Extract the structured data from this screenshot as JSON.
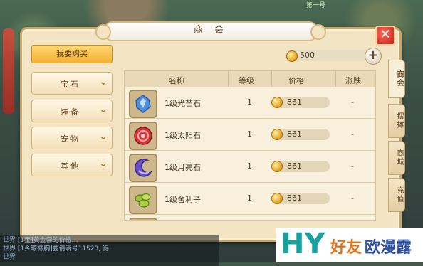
{
  "window": {
    "title": "商 会"
  },
  "background": {
    "top_text": "第一号"
  },
  "actions": {
    "buy_label": "我要购买",
    "money": "500",
    "plus_label": "+"
  },
  "close_label": "✕",
  "categories": [
    {
      "label": "宝石"
    },
    {
      "label": "装备"
    },
    {
      "label": "宠物"
    },
    {
      "label": "其他"
    }
  ],
  "table": {
    "headers": {
      "name": "名称",
      "level": "等级",
      "price": "价格",
      "change": "涨跌"
    },
    "rows": [
      {
        "name": "1级光芒石",
        "level": "1",
        "price": "861",
        "change": "-",
        "icon": "blue-crystal-gem-icon",
        "color": "#4f8fe0"
      },
      {
        "name": "1级太阳石",
        "level": "1",
        "price": "861",
        "change": "-",
        "icon": "red-sun-stone-icon",
        "color": "#d9363b"
      },
      {
        "name": "1级月亮石",
        "level": "1",
        "price": "861",
        "change": "-",
        "icon": "purple-moon-stone-icon",
        "color": "#6b4fc9"
      },
      {
        "name": "1级舍利子",
        "level": "1",
        "price": "861",
        "change": "-",
        "icon": "green-sarira-icon",
        "color": "#9cc23a"
      }
    ]
  },
  "tabs": [
    {
      "label": "商会",
      "active": true
    },
    {
      "label": "摆摊",
      "active": false
    },
    {
      "label": "商城",
      "active": false
    },
    {
      "label": "充值",
      "active": false
    }
  ],
  "chat": [
    "世界 [1宝]黄金套的价格…",
    "世界 [1乡琼德胸]要请滴号11523, 得",
    "世界"
  ],
  "watermark": {
    "hy": "HY",
    "text1": "好友",
    "text2": "欧漫露"
  }
}
